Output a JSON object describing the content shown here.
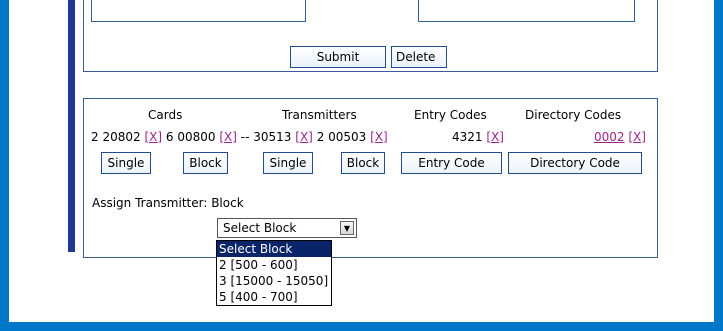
{
  "top_form": {
    "submit_label": "Submit",
    "delete_label": "Delete"
  },
  "columns": {
    "cards": "Cards",
    "transmitters": "Transmitters",
    "entry_codes": "Entry Codes",
    "directory_codes": "Directory Codes"
  },
  "values": {
    "card_1": "2 20802",
    "card_2": "6 00800",
    "separator": "--",
    "transmitter_1": "30513",
    "transmitter_2": "2 00503",
    "entry_code": "4321",
    "directory_code": "0002",
    "remove_label": "[X]"
  },
  "buttons": {
    "cards_single": "Single",
    "cards_block": "Block",
    "transmitters_single": "Single",
    "transmitters_block": "Block",
    "entry_code": "Entry Code",
    "directory_code": "Directory Code"
  },
  "assign": {
    "label": "Assign Transmitter: Block",
    "selected": "Select Block",
    "options": [
      "Select Block",
      "2 [500 - 600]",
      "3 [15000 - 15050]",
      "5 [400 - 700]"
    ]
  },
  "colors": {
    "frame": "#0077c8",
    "side_bar": "#1f3a93",
    "link": "#a0228c",
    "option_highlight": "#0a246a"
  },
  "icons": {
    "select_arrow": "chevron-down-icon"
  }
}
